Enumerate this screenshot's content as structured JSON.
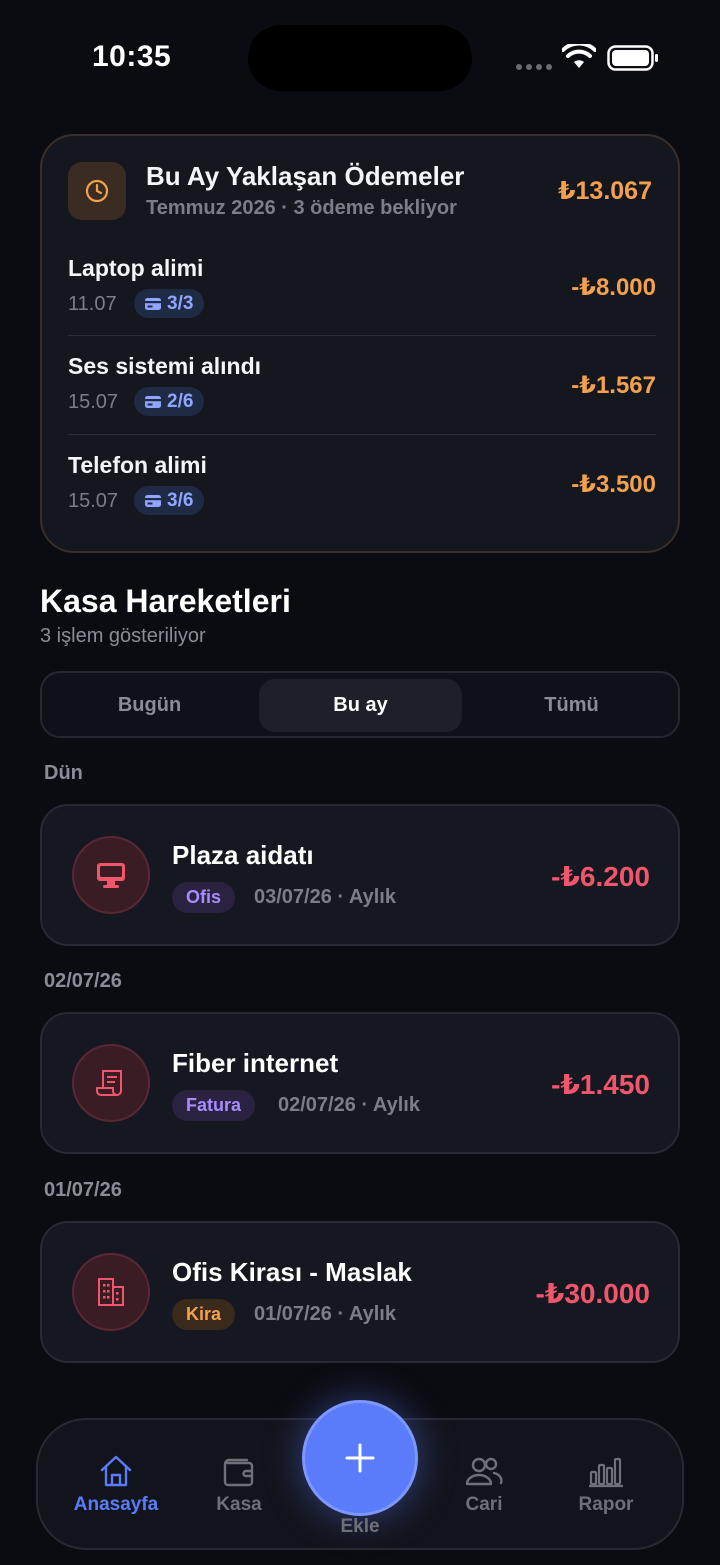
{
  "status_bar": {
    "time": "10:35"
  },
  "upcoming": {
    "title": "Bu Ay Yaklaşan Ödemeler",
    "subtitle": "Temmuz 2026 · 3 ödeme bekliyor",
    "total": "₺13.067",
    "icon": "clock-icon",
    "items": [
      {
        "name": "Laptop alimi",
        "date": "11.07",
        "installment": "3/3",
        "amount": "-₺8.000"
      },
      {
        "name": "Ses sistemi alındı",
        "date": "15.07",
        "installment": "2/6",
        "amount": "-₺1.567"
      },
      {
        "name": "Telefon alimi",
        "date": "15.07",
        "installment": "3/6",
        "amount": "-₺3.500"
      }
    ]
  },
  "section": {
    "title": "Kasa Hareketleri",
    "subtitle": "3 işlem gösteriliyor"
  },
  "filters": {
    "items": [
      "Bugün",
      "Bu ay",
      "Tümü"
    ],
    "selected": "Bu ay"
  },
  "groups": [
    {
      "label": "Dün",
      "tx": {
        "title": "Plaza aidatı",
        "tag": "Ofis",
        "meta": "03/07/26 · Aylık",
        "amount": "-₺6.200",
        "icon": "monitor-icon"
      }
    },
    {
      "label": "02/07/26",
      "tx": {
        "title": "Fiber internet",
        "tag": "Fatura",
        "meta": "02/07/26 · Aylık",
        "amount": "-₺1.450",
        "icon": "receipt-icon"
      }
    },
    {
      "label": "01/07/26",
      "tx": {
        "title": "Ofis Kirası - Maslak",
        "tag": "Kira",
        "meta": "01/07/26 · Aylık",
        "amount": "-₺30.000",
        "icon": "building-icon"
      }
    }
  ],
  "nav": {
    "items": [
      {
        "label": "Anasayfa",
        "icon": "home-icon"
      },
      {
        "label": "Kasa",
        "icon": "wallet-icon"
      },
      {
        "label": "Ekle",
        "icon": "plus-icon"
      },
      {
        "label": "Cari",
        "icon": "users-icon"
      },
      {
        "label": "Rapor",
        "icon": "bar-chart-icon"
      }
    ],
    "active": "Anasayfa"
  },
  "colors": {
    "accent": "#5b7cfa",
    "upcoming_amount": "#f4a14e",
    "expense": "#f2566c",
    "tag_ofis": "#a98bff",
    "tag_fatura": "#a98bff",
    "tag_kira": "#f4a14e"
  }
}
